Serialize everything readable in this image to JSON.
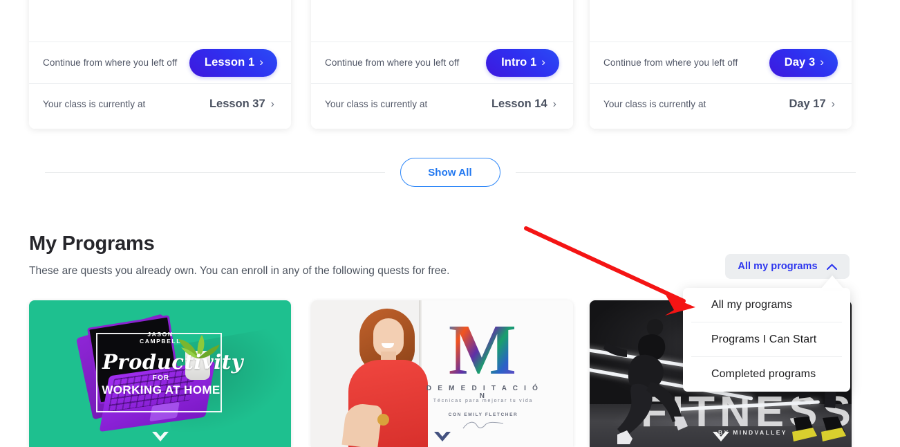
{
  "continue_cards": [
    {
      "continue_label": "Continue from where you left off",
      "continue_button": "Lesson 1",
      "class_label": "Your class is currently at",
      "class_value": "Lesson 37"
    },
    {
      "continue_label": "Continue from where you left off",
      "continue_button": "Intro 1",
      "class_label": "Your class is currently at",
      "class_value": "Lesson 14"
    },
    {
      "continue_label": "Continue from where you left off",
      "continue_button": "Day 3",
      "class_label": "Your class is currently at",
      "class_value": "Day 17"
    }
  ],
  "show_all": {
    "label": "Show All"
  },
  "my_programs": {
    "title": "My Programs",
    "subtitle": "These are quests you already own. You can enroll in any of the following quests for free."
  },
  "filter": {
    "selected": "All my programs",
    "options": [
      "All my programs",
      "Programs I Can Start",
      "Completed programs"
    ]
  },
  "program_cards": [
    {
      "author": "JASON CAMPBELL",
      "title": "Productivity",
      "for": "FOR",
      "subtitle": "WORKING AT HOME",
      "background_color": "#1ec08f"
    },
    {
      "logo_letter": "M",
      "title": "D E   M E D I T A C I Ó N",
      "subtitle": "Técnicas para mejorar\ntu vida",
      "author": "CON EMILY FLETCHER",
      "background_color": "#f3f2f1"
    },
    {
      "title": "FITNESS",
      "subtitle": "BY MINDVALLEY",
      "background_color": "#232326"
    }
  ],
  "colors": {
    "accent_blue": "#2e37ef",
    "link_blue": "#2077f0",
    "pill_gradient_from": "#2B4BF5",
    "pill_gradient_to": "#3E18DE",
    "annotation_red": "#f41414",
    "dropdown_bg": "#eceef0"
  },
  "annotation": {
    "type": "red-arrow",
    "points_to": "All my programs"
  }
}
